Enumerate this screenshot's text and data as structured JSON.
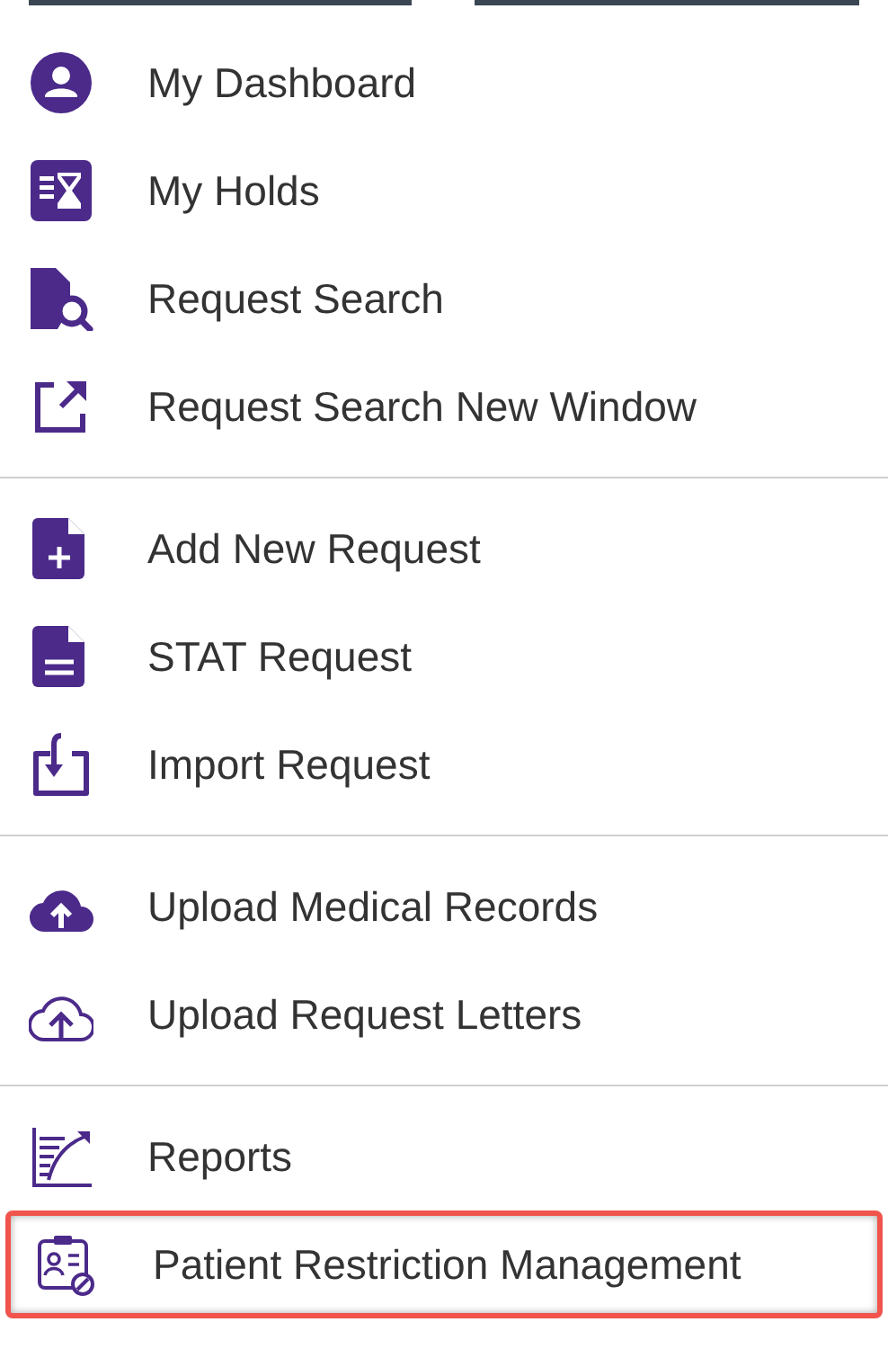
{
  "menu": {
    "groups": [
      {
        "items": [
          {
            "label": "My Dashboard",
            "highlighted": false
          },
          {
            "label": "My Holds",
            "highlighted": false
          },
          {
            "label": "Request Search",
            "highlighted": false
          },
          {
            "label": "Request Search New Window",
            "highlighted": false
          }
        ]
      },
      {
        "items": [
          {
            "label": "Add New Request",
            "highlighted": false
          },
          {
            "label": "STAT Request",
            "highlighted": false
          },
          {
            "label": "Import Request",
            "highlighted": false
          }
        ]
      },
      {
        "items": [
          {
            "label": "Upload Medical Records",
            "highlighted": false
          },
          {
            "label": "Upload Request Letters",
            "highlighted": false
          }
        ]
      },
      {
        "items": [
          {
            "label": "Reports",
            "highlighted": false
          },
          {
            "label": "Patient Restriction Management",
            "highlighted": true
          }
        ]
      }
    ]
  }
}
